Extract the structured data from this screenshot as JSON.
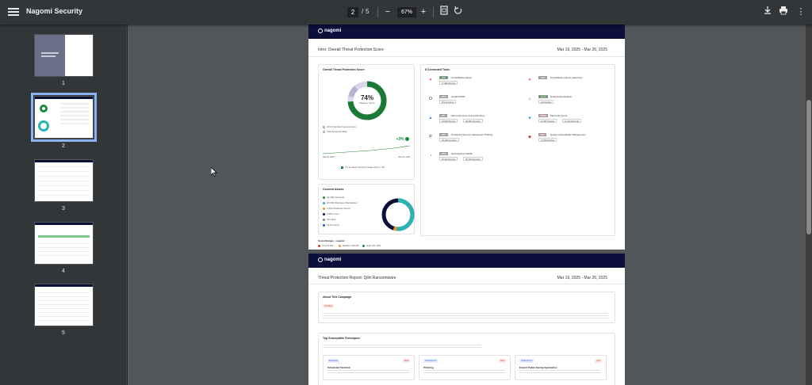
{
  "toolbar": {
    "title": "Nagomi Security",
    "current_page": "2",
    "separator": "/",
    "total_pages": "5",
    "zoom": "67%"
  },
  "thumbnails": [
    {
      "num": "1"
    },
    {
      "num": "2",
      "selected": true
    },
    {
      "num": "3"
    },
    {
      "num": "4"
    },
    {
      "num": "5"
    }
  ],
  "page2": {
    "logo": "nagomi",
    "title": "Intro: Overall Threat Protection Score",
    "date": "Mar 19, 2025 - Mar 26, 2025",
    "score_card": {
      "title": "Overall Threat Protection Score",
      "score": "74%",
      "score_label": "Medium Score",
      "legend_1": "10% Potential Improvement",
      "legend_2": "11% Accepted Risk",
      "trend": "+3%",
      "date_start": "Mar 19, 2025",
      "date_end": "Mar 26, 2025",
      "footnote": "You are above industry average which is 79%"
    },
    "assets_card": {
      "title": "Covered Assets",
      "items": [
        {
          "label": "40,180 Accounts",
          "color": "#1b8a3a"
        },
        {
          "label": "18,400 Windows Workstation",
          "color": "#2ab3b3"
        },
        {
          "label": "2,494 Windows Server",
          "color": "#e69c2c"
        },
        {
          "label": "1,381 Linux",
          "color": "#0b0f3b"
        },
        {
          "label": "511 Mac",
          "color": "#7a7a7a"
        },
        {
          "label": "13 Domains",
          "color": "#3355cc"
        }
      ]
    },
    "ranges": {
      "title": "Score Ranges - Legend",
      "low": "Low (0-50)",
      "medium": "Medium (50-87)",
      "high": "High (87-100)"
    },
    "tools_card": {
      "title": "8 Connected Tools",
      "tools": [
        {
          "badge": "EDR",
          "name": "CrowdStrike Falcon",
          "meta": "17,980 Devices",
          "icon": "falcon-icon",
          "glyph": "✦",
          "color": "#c33",
          "badge_color": "#3a9d4e"
        },
        {
          "badge": "XDR",
          "name": "CrowdStrike Falcon Adversary",
          "meta": "",
          "icon": "falcon-icon",
          "glyph": "✦",
          "color": "#c33",
          "badge_color": "#aaa"
        },
        {
          "badge": "Web",
          "name": "Zscaler/PAM",
          "meta": "872 Accounts",
          "icon": "okta-icon",
          "glyph": "O",
          "color": "#222",
          "badge_color": "#aaa"
        },
        {
          "badge": "Email",
          "name": "Email Authentication",
          "meta": "13 Domains",
          "icon": "mail-icon",
          "glyph": "⌂",
          "color": "#444",
          "badge_color": "#3a9d4e"
        },
        {
          "badge": "IdP",
          "name": "Microsoft Azure Active Directory",
          "meta": "23,805 Devices",
          "meta2": "94,090 Accounts",
          "icon": "azure-icon",
          "glyph": "▲",
          "color": "#2a6fd6",
          "badge_color": "#aaa"
        },
        {
          "badge": "MDM",
          "name": "Microsoft Intune",
          "meta": "21,397 Devices",
          "meta2": "11,210 Accounts",
          "icon": "intune-icon",
          "glyph": "■",
          "color": "#2ab3d6",
          "badge_color": "#e6a0a0"
        },
        {
          "badge": "SAT",
          "name": "Proofpoint Security Awareness Training",
          "meta": "28,125 Accounts",
          "icon": "proofpoint-icon",
          "glyph": "P",
          "color": "#333",
          "badge_color": "#aaa"
        },
        {
          "badge": "VM",
          "name": "Qualys Vulnerability Management",
          "meta": "13,650 Devices",
          "icon": "qualys-icon",
          "glyph": "◆",
          "color": "#c33",
          "badge_color": "#e6a0a0"
        },
        {
          "badge": "EDR",
          "name": "SentinelOne CWDB",
          "meta": "92,419 Devices",
          "meta2": "69,715 Accounts",
          "icon": "sentinel-icon",
          "glyph": "◔",
          "color": "#6a3ac6",
          "badge_color": "#aaa"
        }
      ]
    }
  },
  "page3": {
    "logo": "nagomi",
    "title": "Threat Protection Report: Qilin Ransomware",
    "date": "Mar 19, 2025 - Mar 26, 2025",
    "about_title": "About This Campaign",
    "trending": "Trending",
    "techniques_title": "Top Susceptible Techniques",
    "techniques": [
      {
        "tag": "Execution",
        "sev": "Med",
        "name": "Scheduled Task/Job"
      },
      {
        "tag": "Initial Access",
        "sev": "Med",
        "name": "Phishing"
      },
      {
        "tag": "Initial Access",
        "sev": "Low",
        "name": "Exploit Public-Facing Application"
      }
    ]
  },
  "colors": {
    "navy": "#0b0f3b",
    "green": "#1b8a3a",
    "teal": "#2ab3b3",
    "accent": "#8ab4f8"
  }
}
